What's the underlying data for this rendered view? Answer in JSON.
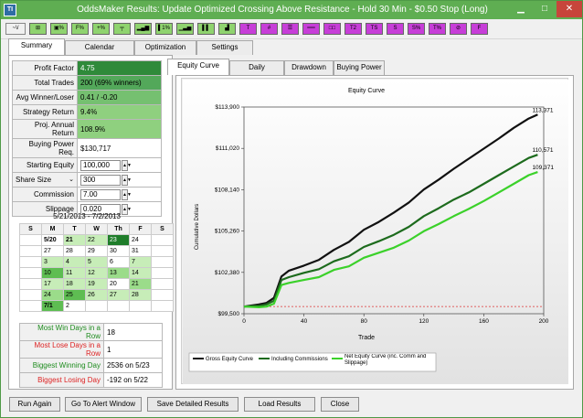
{
  "window": {
    "title": "OddsMaker Results: Update Optimized Crossing Above Resistance - Hold 30 Min - $0.50 Stop (Long)",
    "app_icon": "TI"
  },
  "toolbar": {
    "icons": [
      {
        "name": "w-zigzag-icon",
        "label": "~\\/",
        "color": "plain"
      },
      {
        "name": "bar-arrow-icon",
        "label": "⊞",
        "color": "green"
      },
      {
        "name": "percent-icon",
        "label": "▣%",
        "color": "green"
      },
      {
        "name": "f-percent-icon",
        "label": "F%",
        "color": "green"
      },
      {
        "name": "plus-percent-icon",
        "label": "+%",
        "color": "green"
      },
      {
        "name": "gap-icon",
        "label": "╤",
        "color": "green"
      },
      {
        "name": "bar-chart-icon",
        "label": "▂▄▆",
        "color": "green"
      },
      {
        "name": "ten-percent-icon",
        "label": "▌1%",
        "color": "green"
      },
      {
        "name": "steps-icon",
        "label": "▁▃▅",
        "color": "green"
      },
      {
        "name": "bars-icon",
        "label": "▌▌",
        "color": "green"
      },
      {
        "name": "step-up-icon",
        "label": "▟",
        "color": "green"
      },
      {
        "name": "t-icon",
        "label": "T",
        "color": "purple"
      },
      {
        "name": "th-icon",
        "label": "#",
        "color": "purple"
      },
      {
        "name": "lines-icon",
        "label": "☰",
        "color": "purple"
      },
      {
        "name": "hz-icon",
        "label": "══",
        "color": "purple"
      },
      {
        "name": "dash-icon",
        "label": "□□",
        "color": "purple"
      },
      {
        "name": "t2-icon",
        "label": "T2",
        "color": "purple"
      },
      {
        "name": "ts-icon",
        "label": "TS",
        "color": "purple"
      },
      {
        "name": "sigma-icon",
        "label": "S",
        "color": "purple"
      },
      {
        "name": "s-percent-icon",
        "label": "S%",
        "color": "purple"
      },
      {
        "name": "t-percent-icon",
        "label": "T%",
        "color": "purple"
      },
      {
        "name": "zero-icon",
        "label": "⊘",
        "color": "purple"
      },
      {
        "name": "f-icon",
        "label": "F",
        "color": "purple"
      }
    ]
  },
  "main_tabs": [
    "Summary",
    "Calendar",
    "Optimization",
    "Settings"
  ],
  "stats": [
    {
      "label": "Profit Factor",
      "value": "4.75",
      "cls": "g1"
    },
    {
      "label": "Total Trades",
      "value": "200 (69% winners)",
      "cls": "g2"
    },
    {
      "label": "Avg Winner/Loser",
      "value": "0.41 / -0.20",
      "cls": "g3"
    },
    {
      "label": "Strategy Return",
      "value": "9.4%",
      "cls": "g4"
    },
    {
      "label": "Proj. Annual Return",
      "value": "108.9%",
      "cls": "g4"
    },
    {
      "label": "Buying Power Req.",
      "value": "$130,717",
      "cls": ""
    }
  ],
  "inputs": {
    "starting_equity_label": "Starting Equity",
    "starting_equity": "100,000",
    "share_size_label": "Share Size",
    "share_size": "300",
    "commission_label": "Commission",
    "commission": "7.00",
    "slippage_label": "Slippage",
    "slippage": "0.020"
  },
  "calendar": {
    "range": "5/21/2013 - 7/2/2013",
    "headers": [
      "S",
      "M",
      "T",
      "W",
      "Th",
      "F",
      "S"
    ],
    "rows": [
      [
        {
          "t": "",
          "c": "empty"
        },
        {
          "t": "5/20",
          "c": "cb"
        },
        {
          "t": "21",
          "c": "c4 cb"
        },
        {
          "t": "22",
          "c": "c4"
        },
        {
          "t": "23",
          "c": "c1"
        },
        {
          "t": "24",
          "c": ""
        },
        {
          "t": "",
          "c": "empty"
        }
      ],
      [
        {
          "t": "",
          "c": "empty"
        },
        {
          "t": "27",
          "c": ""
        },
        {
          "t": "28",
          "c": ""
        },
        {
          "t": "29",
          "c": ""
        },
        {
          "t": "30",
          "c": ""
        },
        {
          "t": "31",
          "c": ""
        },
        {
          "t": "",
          "c": "empty"
        }
      ],
      [
        {
          "t": "",
          "c": "empty"
        },
        {
          "t": "3",
          "c": "c4"
        },
        {
          "t": "4",
          "c": "c4"
        },
        {
          "t": "5",
          "c": "c4"
        },
        {
          "t": "6",
          "c": ""
        },
        {
          "t": "7",
          "c": "c4"
        },
        {
          "t": "",
          "c": "empty"
        }
      ],
      [
        {
          "t": "",
          "c": "empty"
        },
        {
          "t": "10",
          "c": "c2"
        },
        {
          "t": "11",
          "c": "c4"
        },
        {
          "t": "12",
          "c": "c4"
        },
        {
          "t": "13",
          "c": "c3"
        },
        {
          "t": "14",
          "c": "c4"
        },
        {
          "t": "",
          "c": "empty"
        }
      ],
      [
        {
          "t": "",
          "c": "empty"
        },
        {
          "t": "17",
          "c": "c4"
        },
        {
          "t": "18",
          "c": "c4"
        },
        {
          "t": "19",
          "c": "c4"
        },
        {
          "t": "20",
          "c": ""
        },
        {
          "t": "21",
          "c": "c3"
        },
        {
          "t": "",
          "c": "empty"
        }
      ],
      [
        {
          "t": "",
          "c": "empty"
        },
        {
          "t": "24",
          "c": "c3"
        },
        {
          "t": "25",
          "c": "c2"
        },
        {
          "t": "26",
          "c": "c4"
        },
        {
          "t": "27",
          "c": "c4"
        },
        {
          "t": "28",
          "c": "c4"
        },
        {
          "t": "",
          "c": "empty"
        }
      ],
      [
        {
          "t": "",
          "c": "empty"
        },
        {
          "t": "7/1",
          "c": "c2 cb"
        },
        {
          "t": "2",
          "c": ""
        },
        {
          "t": "",
          "c": "empty"
        },
        {
          "t": "",
          "c": "empty"
        },
        {
          "t": "",
          "c": "empty"
        },
        {
          "t": "",
          "c": "empty"
        }
      ]
    ]
  },
  "extremes": [
    {
      "label": "Most Win Days in a Row",
      "value": "18",
      "cls": "c-green"
    },
    {
      "label": "Most Lose Days in a Row",
      "value": "1",
      "cls": "c-red"
    },
    {
      "label": "Biggest Winning Day",
      "value": "2536 on 5/23",
      "cls": "c-green"
    },
    {
      "label": "Biggest Losing Day",
      "value": "-192 on 5/22",
      "cls": "c-red"
    }
  ],
  "sub_tabs": [
    "Equity Curve",
    "Daily",
    "Drawdown",
    "Buying Power"
  ],
  "chart_data": {
    "type": "line",
    "title": "Equity Curve",
    "xlabel": "Trade",
    "ylabel": "Cumulative Dollars",
    "xlim": [
      0,
      200
    ],
    "ylim": [
      99500,
      113900
    ],
    "x_ticks": [
      "0",
      "40",
      "80",
      "120",
      "160",
      "200"
    ],
    "y_ticks": [
      "$99,500",
      "$102,380",
      "$105,260",
      "$108,140",
      "$111,020",
      "$113,900"
    ],
    "baseline": 100000,
    "end_labels": [
      "113,371",
      "110,571",
      "109,371"
    ],
    "series": [
      {
        "name": "Gross Equity Curve",
        "color": "#111111",
        "x": [
          0,
          10,
          15,
          20,
          25,
          30,
          40,
          50,
          60,
          70,
          80,
          90,
          100,
          110,
          120,
          130,
          140,
          150,
          160,
          170,
          180,
          190,
          196
        ],
        "y": [
          100000,
          100150,
          100250,
          100600,
          102100,
          102500,
          102850,
          103250,
          103950,
          104500,
          105350,
          105900,
          106550,
          107250,
          108150,
          108850,
          109600,
          110300,
          111000,
          111700,
          112450,
          113100,
          113371
        ]
      },
      {
        "name": "Including Commissions",
        "color": "#1d6b1d",
        "x": [
          0,
          10,
          15,
          20,
          25,
          30,
          40,
          50,
          60,
          70,
          80,
          90,
          100,
          110,
          120,
          130,
          140,
          150,
          160,
          170,
          180,
          190,
          196
        ],
        "y": [
          100000,
          100050,
          100150,
          100400,
          101850,
          102050,
          102350,
          102600,
          103150,
          103500,
          104150,
          104550,
          105000,
          105550,
          106300,
          106850,
          107450,
          107950,
          108550,
          109150,
          109750,
          110350,
          110571
        ]
      },
      {
        "name": "Net Equity Curve (inc. Comm and Slippage)",
        "color": "#3bd12a",
        "x": [
          0,
          10,
          15,
          20,
          25,
          30,
          40,
          50,
          60,
          70,
          80,
          90,
          100,
          110,
          120,
          130,
          140,
          150,
          160,
          170,
          180,
          190,
          196
        ],
        "y": [
          100000,
          99950,
          100000,
          100200,
          101500,
          101650,
          101850,
          102050,
          102550,
          102800,
          103400,
          103750,
          104100,
          104600,
          105250,
          105750,
          106300,
          106800,
          107350,
          107950,
          108550,
          109150,
          109371
        ]
      }
    ]
  },
  "bottom_buttons": [
    "Run Again",
    "Go To Alert Window",
    "Save Detailed Results",
    "Load Results",
    "Close"
  ]
}
